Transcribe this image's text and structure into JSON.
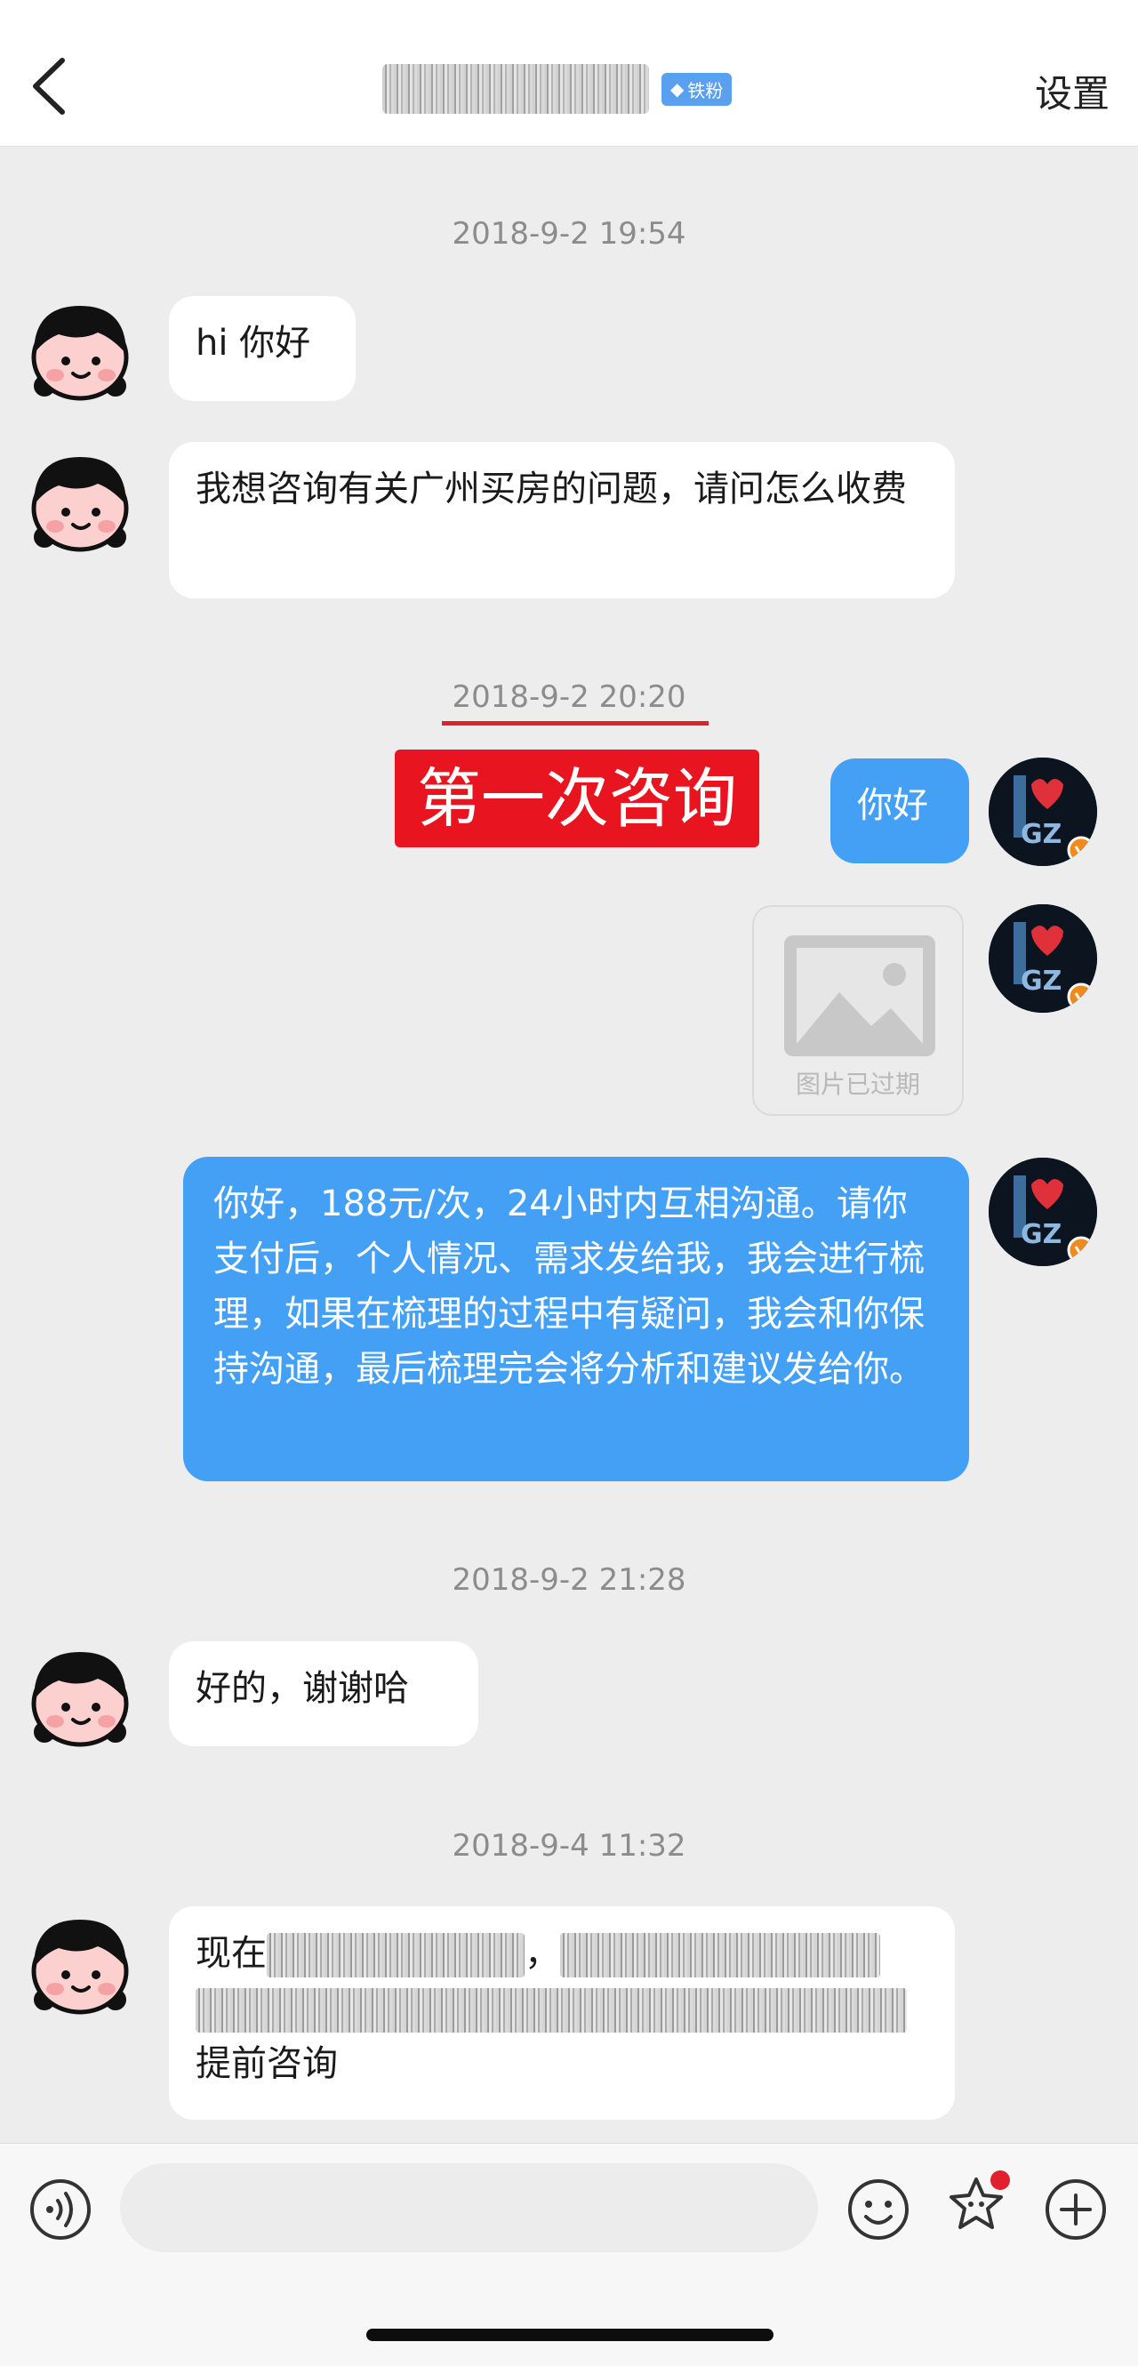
{
  "header": {
    "fan_badge": "铁粉",
    "settings_label": "设置"
  },
  "messages": {
    "ts1": "2018-9-2 19:54",
    "m1": "hi 你好",
    "m2": "我想咨询有关广州买房的问题，请问怎么收费",
    "ts2": "2018-9-2 20:20",
    "first_consult_label": "第一次咨询",
    "m3": "你好",
    "expired_image_label": "图片已过期",
    "m4": "你好，188元/次，24小时内互相沟通。请你支付后，个人情况、需求发给我，我会进行梳理，如果在梳理的过程中有疑问，我会和你保持沟通，最后梳理完会将分析和建议发给你。",
    "ts3": "2018-9-2 21:28",
    "m5": "好的，谢谢哈",
    "ts4": "2018-9-4 11:32",
    "m6_prefix": "现在",
    "m6_comma": "，",
    "m6_suffix": "提前咨询"
  },
  "input": {
    "placeholder": ""
  },
  "colors": {
    "self_bubble": "#44a0f5",
    "other_bubble": "#ffffff",
    "highlight_red": "#e8141f",
    "badge_blue": "#5aa0f0",
    "background": "#ededed"
  },
  "icons": {
    "back": "chevron-left-icon",
    "voice": "voice-icon",
    "emoji": "emoji-icon",
    "favorite": "star-face-icon",
    "add": "plus-icon"
  }
}
